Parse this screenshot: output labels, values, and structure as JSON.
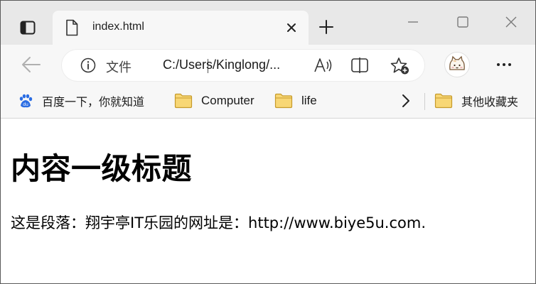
{
  "tab": {
    "title": "index.html"
  },
  "address_bar": {
    "file_label": "文件",
    "url": "C:/Users/Kinglong/..."
  },
  "favorites": {
    "items": [
      {
        "label": "百度一下，你就知道",
        "icon": "baidu-icon"
      },
      {
        "label": "Computer",
        "icon": "folder-icon"
      },
      {
        "label": "life",
        "icon": "folder-icon"
      }
    ],
    "other": {
      "label": "其他收藏夹",
      "icon": "folder-icon"
    }
  },
  "page": {
    "heading": "内容一级标题",
    "paragraph": "这是段落：翔宇亭IT乐园的网址是：http://www.biye5u.com."
  },
  "colors": {
    "titlebar_bg": "#e8e8e8",
    "toolbar_bg": "#f7f7f7",
    "folder_fill": "#f8d775",
    "folder_stroke": "#c69a2b",
    "baidu_blue": "#2b6de3"
  }
}
